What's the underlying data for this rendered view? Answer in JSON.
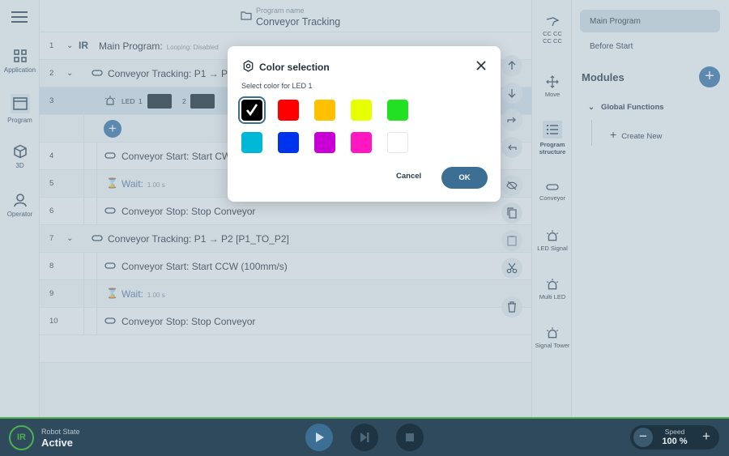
{
  "header": {
    "program_name_label": "Program name",
    "program_name": "Conveyor Tracking"
  },
  "nav": {
    "items": [
      {
        "label": "Application",
        "icon": "grid-icon"
      },
      {
        "label": "Program",
        "icon": "program-icon",
        "active": true
      },
      {
        "label": "3D",
        "icon": "cube-icon"
      },
      {
        "label": "Operator",
        "icon": "person-icon"
      }
    ]
  },
  "program": {
    "rows": [
      {
        "num": "1",
        "text": "Main Program:",
        "meta": "Looping:  Disabled"
      },
      {
        "num": "2",
        "text": "Conveyor Tracking:  P1 → P2"
      },
      {
        "num": "3",
        "led_label": "LED",
        "led_1": "1",
        "led_2": "2"
      },
      {
        "num": "4",
        "text": "Conveyor Start:  Start CW"
      },
      {
        "num": "5",
        "text": "Wait:",
        "meta": "1.00 s"
      },
      {
        "num": "6",
        "text": "Conveyor Stop:  Stop Conveyor"
      },
      {
        "num": "7",
        "text": "Conveyor Tracking:  P1 → P2 [P1_TO_P2]"
      },
      {
        "num": "8",
        "text": "Conveyor Start:  Start CCW (100mm/s)"
      },
      {
        "num": "9",
        "text": "Wait:",
        "meta": "1.00 s"
      },
      {
        "num": "10",
        "text": "Conveyor Stop:  Stop Conveyor"
      }
    ]
  },
  "toolbox": {
    "items": [
      {
        "label": "CC CC\nCC CC",
        "icon": "robot-arm-icon"
      },
      {
        "label": "Move",
        "icon": "move-icon"
      },
      {
        "label": "Program structure",
        "icon": "list-icon",
        "active": true
      },
      {
        "label": "Conveyor",
        "icon": "conveyor-icon"
      },
      {
        "label": "LED Signal",
        "icon": "led-signal-icon"
      },
      {
        "label": "Multi LED",
        "icon": "multi-led-icon"
      },
      {
        "label": "Signal Tower",
        "icon": "signal-tower-icon"
      }
    ]
  },
  "right_panel": {
    "main_program": "Main Program",
    "before_start": "Before Start",
    "modules": "Modules",
    "global_functions": "Global Functions",
    "create_new": "Create New"
  },
  "dialog": {
    "title": "Color selection",
    "subtitle": "Select color for LED 1",
    "selected_color": "#000000",
    "colors": [
      "#000000",
      "#ff0000",
      "#ffc000",
      "#e8ff00",
      "#22e022",
      "#00b7d8",
      "#0033ee",
      "#c800d6",
      "#ff18c0",
      "#ffffff"
    ],
    "cancel_label": "Cancel",
    "ok_label": "OK"
  },
  "status": {
    "robot_state_label": "Robot State",
    "robot_state": "Active",
    "logo_text": "ΙR",
    "speed_label": "Speed",
    "speed_value": "100 %",
    "accent": "#4caf50"
  }
}
